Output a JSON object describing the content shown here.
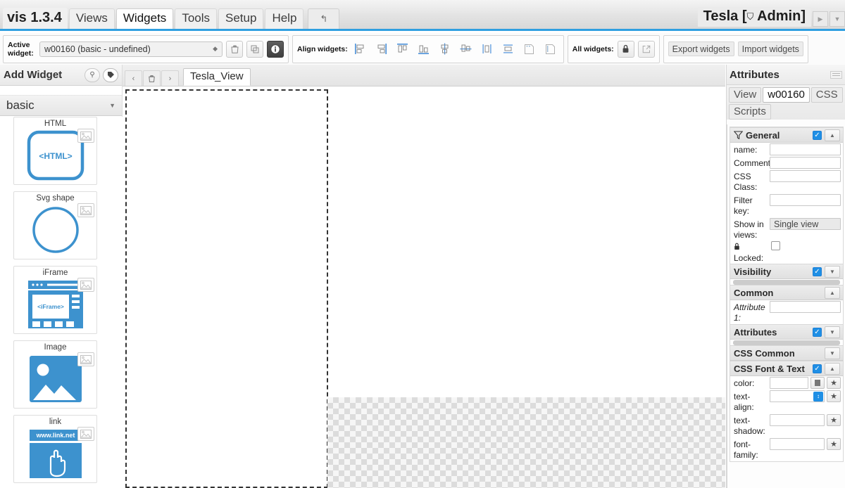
{
  "menubar": {
    "brand": "vis 1.3.4",
    "items": [
      {
        "label": "Views",
        "active": false
      },
      {
        "label": "Widgets",
        "active": true
      },
      {
        "label": "Tools",
        "active": false
      },
      {
        "label": "Setup",
        "active": false
      },
      {
        "label": "Help",
        "active": false
      }
    ],
    "undo_icon": "undo-arrow-icon",
    "title": "Tesla [",
    "title_lock": "⛉",
    "title_user": "Admin]",
    "nav_next": "▶",
    "nav_more": "▼"
  },
  "toolbar": {
    "active_widget_label_l1": "Active",
    "active_widget_label_l2": "widget:",
    "active_widget_value": "w00160  (basic - undefined)",
    "delete_icon": "trash-icon",
    "copy_icon": "copy-icon",
    "info_icon": "info-icon",
    "align_label": "Align widgets:",
    "align_buttons": [
      "align-left-icon",
      "align-right-icon",
      "align-top-icon",
      "align-bottom-icon",
      "align-center-vertical-icon",
      "align-center-horizontal-icon",
      "distribute-horizontal-icon",
      "distribute-vertical-icon",
      "same-width-icon",
      "same-height-icon"
    ],
    "all_widgets_label": "All widgets:",
    "lock_icon": "lock-icon",
    "unlock_icon": "external-link-icon",
    "export_label": "Export widgets",
    "import_label": "Import widgets"
  },
  "left_panel": {
    "title": "Add Widget",
    "search_icon": "magnifier-icon",
    "filter_icon": "tag-icon",
    "category": "basic",
    "widgets": [
      {
        "name": "HTML",
        "preview": "html-widget-preview",
        "label": "<HTML>"
      },
      {
        "name": "Svg shape",
        "preview": "svg-shape-widget-preview",
        "label": ""
      },
      {
        "name": "iFrame",
        "preview": "iframe-widget-preview",
        "label": "<iFrame>"
      },
      {
        "name": "Image",
        "preview": "image-widget-preview",
        "label": ""
      },
      {
        "name": "link",
        "preview": "link-widget-preview",
        "label": "www.link.net"
      }
    ]
  },
  "view_bar": {
    "prev_icon": "chevron-left-icon",
    "delete_icon": "trash-small-icon",
    "next_icon": "chevron-right-icon",
    "tab_label": "Tesla_View"
  },
  "attributes": {
    "title": "Attributes",
    "tabs": [
      {
        "label": "View",
        "active": false
      },
      {
        "label": "w00160",
        "active": true
      },
      {
        "label": "CSS",
        "active": false
      },
      {
        "label": "Scripts",
        "active": false
      }
    ],
    "sections": [
      {
        "name": "General",
        "checked": true,
        "expanded": true,
        "fields": [
          {
            "label": "name:",
            "value": "",
            "type": "text"
          },
          {
            "label": "Comment:",
            "value": "",
            "type": "text"
          },
          {
            "label": "CSS Class:",
            "value": "",
            "type": "text"
          },
          {
            "label": "Filter key:",
            "value": "",
            "type": "text"
          },
          {
            "label": "Show in views:",
            "value": "Single view",
            "type": "select"
          },
          {
            "label": "Locked:",
            "value": "",
            "type": "checkbox",
            "checked": false,
            "icon": "lock-icon"
          }
        ]
      },
      {
        "name": "Visibility",
        "checked": true,
        "expanded": false,
        "fields": []
      },
      {
        "name": "Common",
        "checked": null,
        "expanded": true,
        "fields": [
          {
            "label": "Attribute 1:",
            "value": "",
            "type": "text",
            "italic": true
          }
        ]
      },
      {
        "name": "Attributes",
        "checked": true,
        "expanded": false,
        "fields": []
      },
      {
        "name": "CSS Common",
        "checked": null,
        "expanded": false,
        "fields": []
      },
      {
        "name": "CSS Font & Text",
        "checked": true,
        "expanded": true,
        "fields": [
          {
            "label": "color:",
            "value": "",
            "type": "color"
          },
          {
            "label": "text-align:",
            "value": "",
            "type": "spinner"
          },
          {
            "label": "text-shadow:",
            "value": "",
            "type": "text-star"
          },
          {
            "label": "font-family:",
            "value": "",
            "type": "text-star"
          }
        ]
      }
    ]
  },
  "colors": {
    "accent": "#2f9fe0",
    "checkbox_blue": "#1f8fe5",
    "widget_blue": "#3d92ce",
    "panel_bg": "#ececec"
  }
}
